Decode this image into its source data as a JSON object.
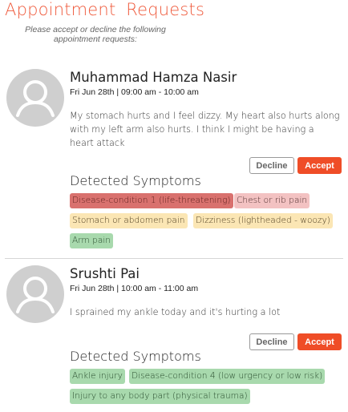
{
  "page": {
    "title": "Appointment Requests",
    "subtitle": "Please accept or decline the following appointment requests:"
  },
  "requests": [
    {
      "name": "Muhammad Hamza Nasir",
      "datetime": "Fri Jun 28th | 09:00 am - 10:00 am",
      "message": "My stomach hurts and I feel dizzy. My heart also hurts along with my left arm also hurts. I think I might be having a heart attack",
      "decline_label": "Decline",
      "accept_label": "Accept",
      "symptoms_heading": "Detected Symptoms",
      "symptoms": [
        {
          "label": "Disease-condition 1 (life-threatening)",
          "severity": "red"
        },
        {
          "label": "Chest or rib pain",
          "severity": "pink"
        },
        {
          "label": "Stomach or abdomen pain",
          "severity": "yellow"
        },
        {
          "label": "Dizziness (lightheaded - woozy)",
          "severity": "yellow"
        },
        {
          "label": "Arm pain",
          "severity": "green"
        }
      ]
    },
    {
      "name": "Srushti Pai",
      "datetime": "Fri Jun 28th | 10:00 am - 11:00 am",
      "message": "I sprained my ankle today and it's hurting a lot",
      "decline_label": "Decline",
      "accept_label": "Accept",
      "symptoms_heading": "Detected Symptoms",
      "symptoms": [
        {
          "label": "Ankle injury",
          "severity": "green"
        },
        {
          "label": "Disease-condition 4 (low urgency or low risk)",
          "severity": "green"
        },
        {
          "label": "Injury to any body part (physical trauma)",
          "severity": "green"
        }
      ]
    }
  ],
  "colors": {
    "accent": "#ef4d27",
    "title": "#ef5a3c",
    "severity_red": "#d9716e",
    "severity_pink": "#f3c2c2",
    "severity_yellow": "#fbe6b4",
    "severity_green": "#a8d9ad"
  }
}
